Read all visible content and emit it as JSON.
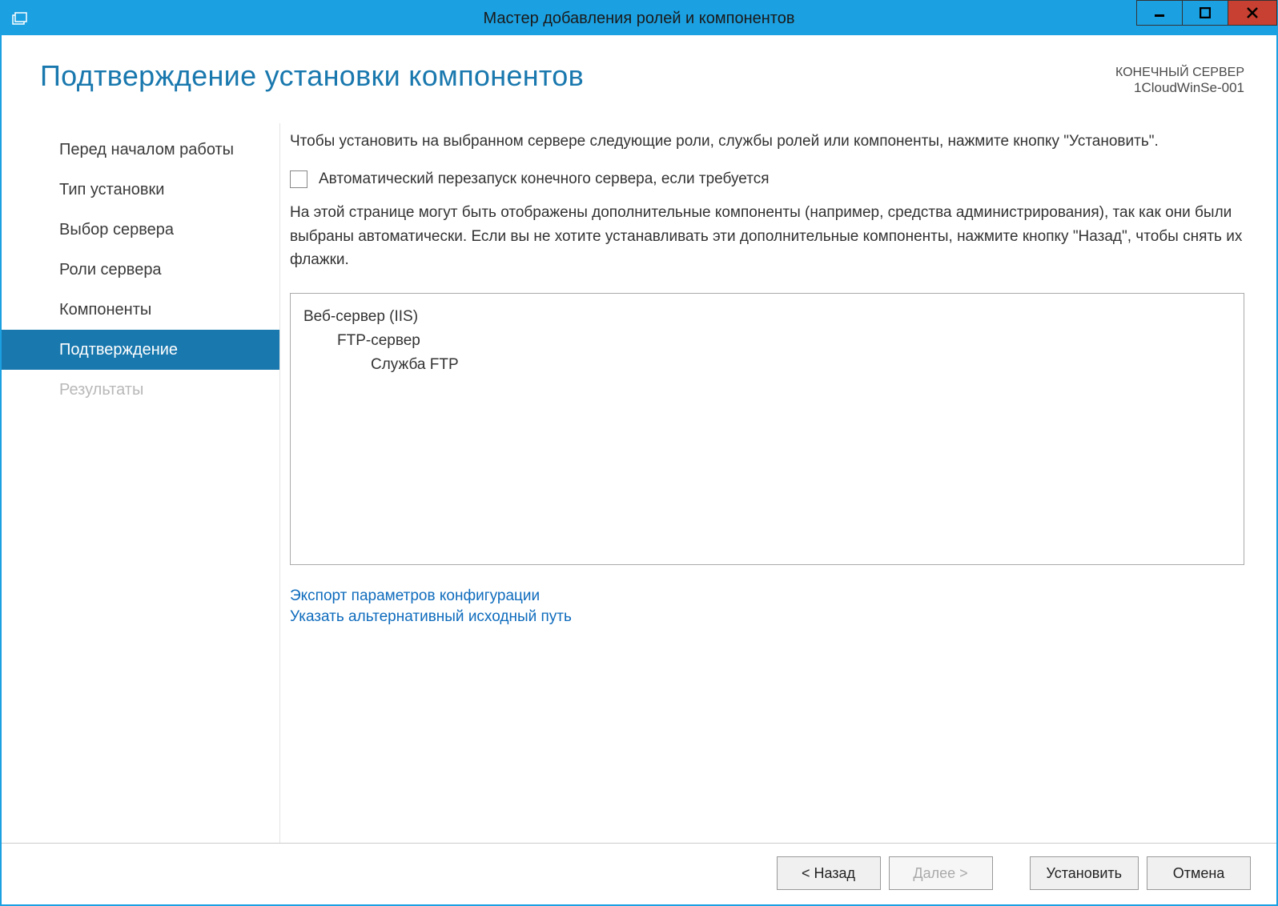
{
  "titlebar": {
    "title": "Мастер добавления ролей и компонентов"
  },
  "header": {
    "heading": "Подтверждение установки компонентов",
    "dest_label": "КОНЕЧНЫЙ СЕРВЕР",
    "dest_name": "1CloudWinSe-001"
  },
  "sidebar": {
    "items": [
      {
        "label": "Перед началом работы",
        "state": "normal"
      },
      {
        "label": "Тип установки",
        "state": "normal"
      },
      {
        "label": "Выбор сервера",
        "state": "normal"
      },
      {
        "label": "Роли сервера",
        "state": "normal"
      },
      {
        "label": "Компоненты",
        "state": "normal"
      },
      {
        "label": "Подтверждение",
        "state": "selected"
      },
      {
        "label": "Результаты",
        "state": "disabled"
      }
    ]
  },
  "content": {
    "intro": "Чтобы установить на выбранном сервере следующие роли, службы ролей или компоненты, нажмите кнопку \"Установить\".",
    "checkbox_label": "Автоматический перезапуск конечного сервера, если требуется",
    "note": "На этой странице могут быть отображены дополнительные компоненты (например, средства администрирования), так как они были выбраны автоматически. Если вы не хотите устанавливать эти дополнительные компоненты, нажмите кнопку \"Назад\", чтобы снять их флажки.",
    "tree": {
      "l0": "Веб-сервер (IIS)",
      "l1": "FTP-сервер",
      "l2": "Служба FTP"
    },
    "links": {
      "export": "Экспорт параметров конфигурации",
      "altpath": "Указать альтернативный исходный путь"
    }
  },
  "footer": {
    "back": "< Назад",
    "next": "Далее >",
    "install": "Установить",
    "cancel": "Отмена"
  }
}
